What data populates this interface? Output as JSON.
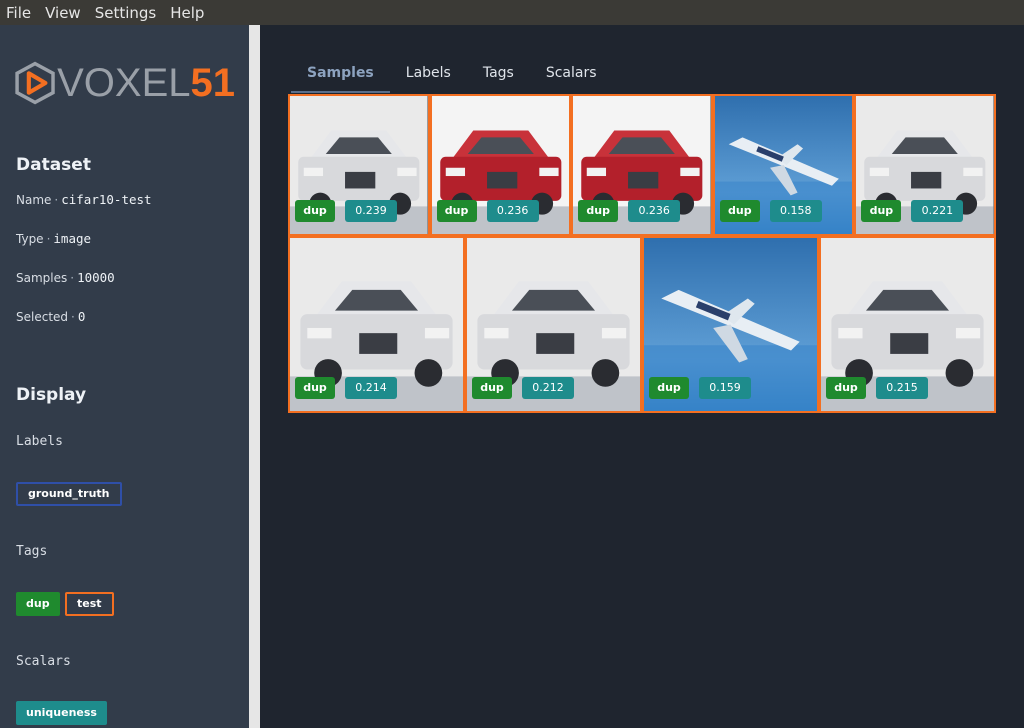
{
  "menu": [
    "File",
    "View",
    "Settings",
    "Help"
  ],
  "logo": {
    "text_a": "VOXEL",
    "text_b": "51"
  },
  "dataset": {
    "title": "Dataset",
    "name_label": "Name",
    "name_value": "cifar10-test",
    "type_label": "Type",
    "type_value": "image",
    "samples_label": "Samples",
    "samples_value": "10000",
    "selected_label": "Selected",
    "selected_value": "0"
  },
  "display": {
    "title": "Display",
    "labels_title": "Labels",
    "labels": [
      "ground_truth"
    ],
    "tags_title": "Tags",
    "tags": [
      "dup",
      "test"
    ],
    "scalars_title": "Scalars",
    "scalars": [
      "uniqueness"
    ]
  },
  "tabs": [
    "Samples",
    "Labels",
    "Tags",
    "Scalars"
  ],
  "active_tab": "Samples",
  "samples": [
    {
      "kind": "white-car",
      "tag": "dup",
      "score": "0.239"
    },
    {
      "kind": "red-car",
      "tag": "dup",
      "score": "0.236"
    },
    {
      "kind": "red-car",
      "tag": "dup",
      "score": "0.236"
    },
    {
      "kind": "airplane",
      "tag": "dup",
      "score": "0.158"
    },
    {
      "kind": "white-car",
      "tag": "dup",
      "score": "0.221"
    },
    {
      "kind": "white-suv",
      "tag": "dup",
      "score": "0.214"
    },
    {
      "kind": "white-suv",
      "tag": "dup",
      "score": "0.212"
    },
    {
      "kind": "airplane",
      "tag": "dup",
      "score": "0.159"
    },
    {
      "kind": "white-car-rear",
      "tag": "dup",
      "score": "0.215"
    }
  ],
  "colors": {
    "accent": "#f36f21",
    "dup_badge": "#1f8a2e",
    "score_badge": "#1e8c8c",
    "label_border": "#2f4fa8",
    "sidebar_bg": "#323c4a",
    "main_bg": "#1f252f"
  }
}
